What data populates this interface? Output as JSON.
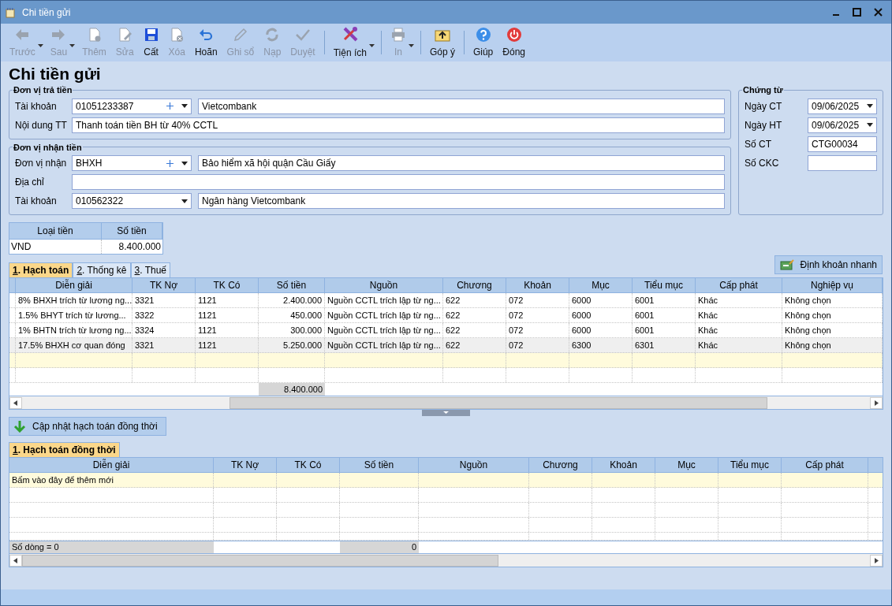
{
  "window": {
    "title": "Chi tiền gửi"
  },
  "toolbar": [
    {
      "label": "Trước",
      "enabled": false,
      "dropdown": true,
      "separator_before": false
    },
    {
      "label": "Sau",
      "enabled": false,
      "dropdown": true,
      "separator_before": false
    },
    {
      "label": "Thêm",
      "enabled": false,
      "dropdown": false,
      "separator_before": false
    },
    {
      "label": "Sửa",
      "enabled": false,
      "dropdown": false,
      "separator_before": false
    },
    {
      "label": "Cất",
      "enabled": true,
      "dropdown": false,
      "separator_before": false
    },
    {
      "label": "Xóa",
      "enabled": false,
      "dropdown": false,
      "separator_before": false
    },
    {
      "label": "Hoãn",
      "enabled": true,
      "dropdown": false,
      "separator_before": false
    },
    {
      "label": "Ghi sổ",
      "enabled": false,
      "dropdown": false,
      "separator_before": false
    },
    {
      "label": "Nạp",
      "enabled": false,
      "dropdown": false,
      "separator_before": false
    },
    {
      "label": "Duyệt",
      "enabled": false,
      "dropdown": false,
      "separator_before": false
    },
    {
      "label": "Tiện ích",
      "enabled": true,
      "dropdown": true,
      "separator_before": true
    },
    {
      "label": "In",
      "enabled": false,
      "dropdown": true,
      "separator_before": true
    },
    {
      "label": "Góp ý",
      "enabled": true,
      "dropdown": false,
      "separator_before": true
    },
    {
      "label": "Giúp",
      "enabled": true,
      "dropdown": false,
      "separator_before": true
    },
    {
      "label": "Đóng",
      "enabled": true,
      "dropdown": false,
      "separator_before": false
    }
  ],
  "heading": "Chi tiền gửi",
  "payer": {
    "title": "Đơn vị trả tiền",
    "rows": [
      {
        "kind": "combo",
        "label": "Tài khoản",
        "value": "01051233387",
        "add": true,
        "name": "Vietcombank"
      },
      {
        "kind": "text",
        "label": "Nội dung TT",
        "value": "Thanh toán tiền BH từ 40% CCTL"
      }
    ]
  },
  "receiver": {
    "title": "Đơn vị nhận tiền",
    "rows": [
      {
        "kind": "combo",
        "label": "Đơn vị nhận",
        "value": "BHXH",
        "add": true,
        "name": "Bảo hiểm xã hội quận Cầu Giấy"
      },
      {
        "kind": "text",
        "label": "Địa chỉ"
      },
      {
        "kind": "combo",
        "label": "Tài khoản",
        "value": "010562322",
        "add": false,
        "name": "Ngân hàng Vietcombank"
      }
    ]
  },
  "voucher": {
    "title": "Chứng từ",
    "rows": [
      {
        "kind": "date",
        "label": "Ngày CT",
        "value": "09/06/2025"
      },
      {
        "kind": "date",
        "label": "Ngày HT",
        "value": "09/06/2025"
      },
      {
        "kind": "text",
        "label": "Số CT",
        "value": "CTG00034"
      },
      {
        "kind": "text",
        "label": "Số CKC"
      }
    ]
  },
  "currency_table": {
    "columns": [
      "Loại tiền",
      "Số tiền"
    ],
    "rows": [
      [
        "VND",
        "8.400.000"
      ]
    ]
  },
  "tabs": [
    {
      "label": "1. Hạch toán",
      "selected": true
    },
    {
      "label": "2. Thống kê",
      "selected": false
    },
    {
      "label": "3. Thuế",
      "selected": false
    }
  ],
  "quick_entry_button": "Định khoản nhanh",
  "entries": {
    "columns": [
      {
        "label": "Diễn giải"
      },
      {
        "label": "TK Nợ"
      },
      {
        "label": "TK Có"
      },
      {
        "label": "Số tiền"
      },
      {
        "label": "Nguồn"
      },
      {
        "label": "Chương"
      },
      {
        "label": "Khoản"
      },
      {
        "label": "Mục"
      },
      {
        "label": "Tiểu mục"
      },
      {
        "label": "Cấp phát"
      },
      {
        "label": "Nghiệp vụ"
      }
    ],
    "rows": [
      {
        "selected": false,
        "cells": [
          "8% BHXH trích từ lương ng...",
          "3321",
          "1121",
          "2.400.000",
          "Nguồn CCTL trích lập từ ng...",
          "622",
          "072",
          "6000",
          "6001",
          "Khác",
          "Không chọn"
        ]
      },
      {
        "selected": false,
        "cells": [
          "1.5% BHYT trích từ lương...",
          "3322",
          "1121",
          "450.000",
          "Nguồn CCTL trích lập từ ng...",
          "622",
          "072",
          "6000",
          "6001",
          "Khác",
          "Không chọn"
        ]
      },
      {
        "selected": false,
        "cells": [
          "1% BHTN trích từ lương ng...",
          "3324",
          "1121",
          "300.000",
          "Nguồn CCTL trích lập từ ng...",
          "622",
          "072",
          "6000",
          "6001",
          "Khác",
          "Không chọn"
        ]
      },
      {
        "selected": true,
        "cells": [
          "17.5% BHXH cơ quan đóng",
          "3321",
          "1121",
          "5.250.000",
          "Nguồn CCTL trích lập từ ng...",
          "622",
          "072",
          "6300",
          "6301",
          "Khác",
          "Không chọn"
        ]
      }
    ],
    "total": "8.400.000"
  },
  "update_button": "Cập nhật hạch toán đồng thời",
  "tabs_2": [
    {
      "label": "1. Hạch toán đồng thời",
      "selected": true
    }
  ],
  "concurrent_entries": {
    "columns": [
      {
        "label": "Diễn giải"
      },
      {
        "label": "TK Nợ"
      },
      {
        "label": "TK Có"
      },
      {
        "label": "Số tiền"
      },
      {
        "label": "Nguồn"
      },
      {
        "label": "Chương"
      },
      {
        "label": "Khoản"
      },
      {
        "label": "Mục"
      },
      {
        "label": "Tiểu mục"
      },
      {
        "label": "Cấp phát"
      }
    ],
    "new_row_hint": "Bấm vào đây để thêm mới",
    "row_count": "Số dòng = 0",
    "total": "0"
  }
}
